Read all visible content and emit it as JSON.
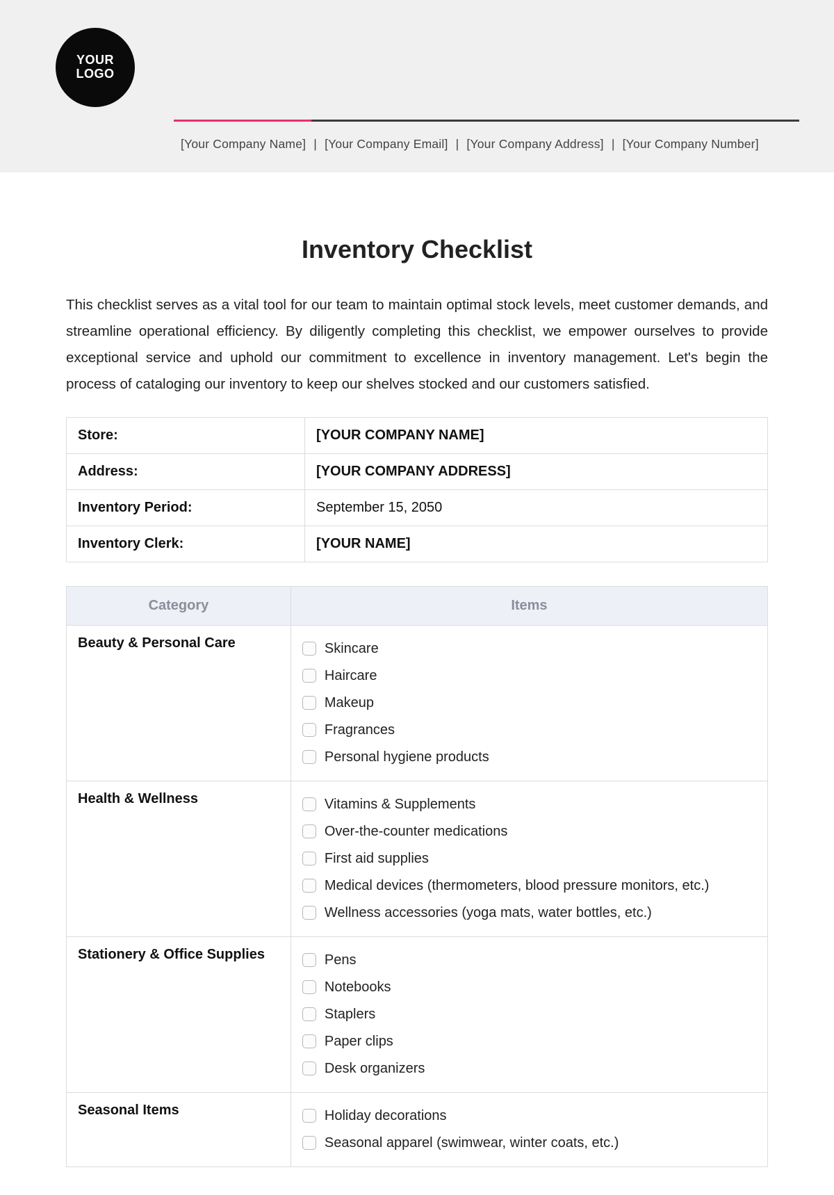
{
  "logo": {
    "line1": "YOUR",
    "line2": "LOGO"
  },
  "company_line": {
    "name": "[Your Company Name]",
    "email": "[Your Company Email]",
    "address": "[Your Company Address]",
    "phone": "[Your Company Number]"
  },
  "title": "Inventory Checklist",
  "intro": "This checklist serves as a vital tool for our team to maintain optimal stock levels, meet customer demands, and streamline operational efficiency. By diligently completing this checklist, we empower ourselves to provide exceptional service and uphold our commitment to excellence in inventory management. Let's begin the process of cataloging our inventory to keep our shelves stocked and our customers satisfied.",
  "info": [
    {
      "label": "Store:",
      "value": "[YOUR COMPANY NAME]",
      "bold": true
    },
    {
      "label": "Address:",
      "value": "[YOUR COMPANY ADDRESS]",
      "bold": true
    },
    {
      "label": "Inventory Period:",
      "value": "September 15, 2050",
      "bold": false
    },
    {
      "label": "Inventory Clerk:",
      "value": "[YOUR NAME]",
      "bold": true
    }
  ],
  "items_header": {
    "category": "Category",
    "items": "Items"
  },
  "categories": [
    {
      "name": "Beauty & Personal Care",
      "items": [
        "Skincare",
        "Haircare",
        "Makeup",
        "Fragrances",
        "Personal hygiene products"
      ]
    },
    {
      "name": "Health & Wellness",
      "items": [
        "Vitamins & Supplements",
        "Over-the-counter medications",
        "First aid supplies",
        "Medical devices (thermometers, blood pressure monitors, etc.)",
        "Wellness accessories (yoga mats, water bottles, etc.)"
      ]
    },
    {
      "name": "Stationery & Office Supplies",
      "items": [
        "Pens",
        "Notebooks",
        "Staplers",
        "Paper clips",
        "Desk organizers"
      ]
    },
    {
      "name": "Seasonal Items",
      "items": [
        "Holiday decorations",
        "Seasonal apparel (swimwear, winter coats, etc.)"
      ]
    }
  ]
}
